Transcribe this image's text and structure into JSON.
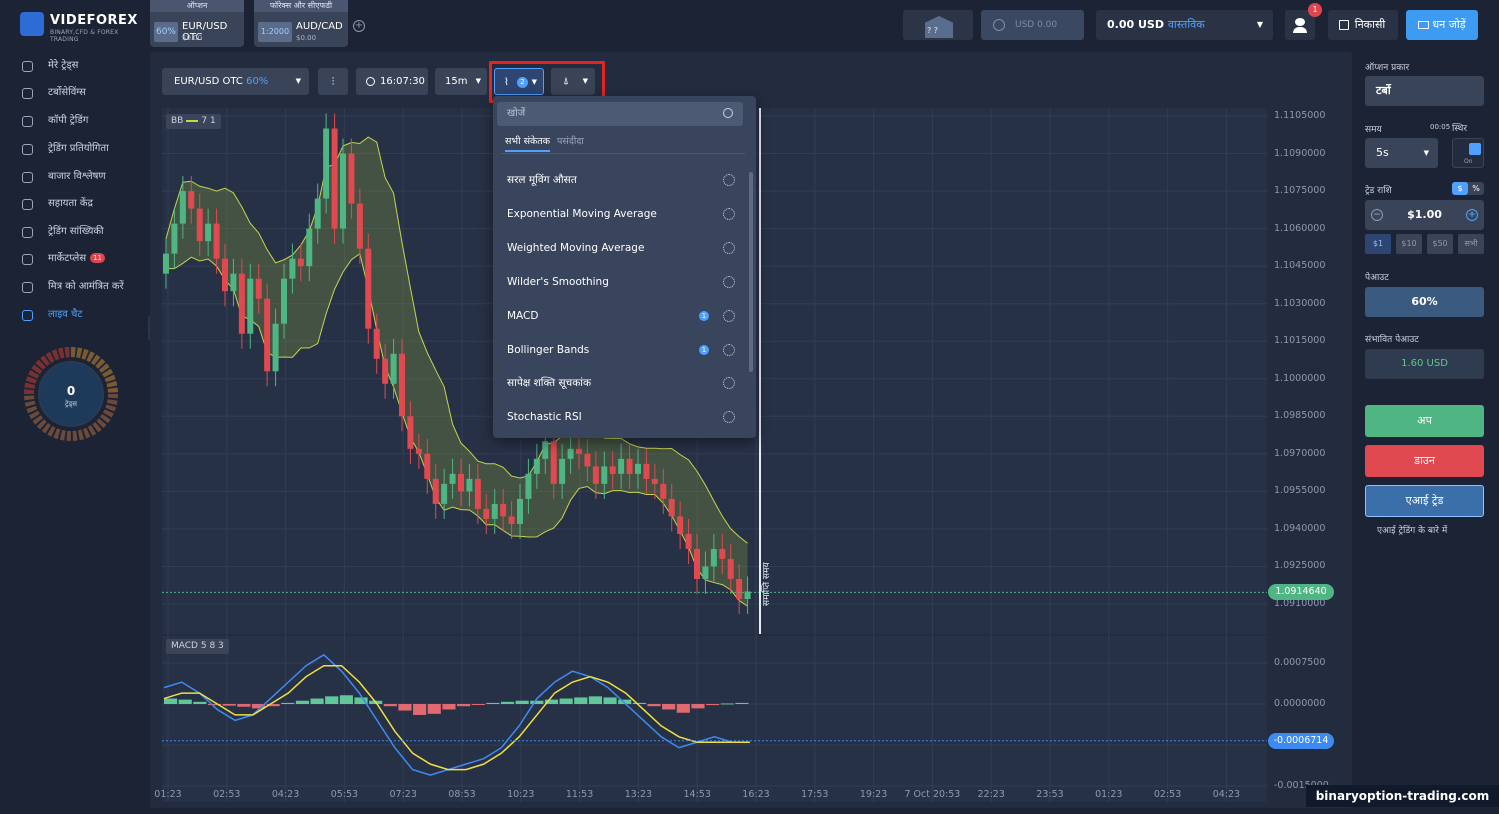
{
  "brand": {
    "name": "VIDEFOREX",
    "tagline": "BINARY,CFD & FOREX TRADING"
  },
  "asset_tabs": [
    {
      "category": "ऑप्शन",
      "pct": "60%",
      "name": "EUR/USD OTC",
      "amount": "$0.00"
    },
    {
      "category": "फॉरेक्स और सीएफडी",
      "pct": "1:2000",
      "name": "AUD/CAD",
      "amount": "$0.00"
    }
  ],
  "header": {
    "demo_balance": "USD 0.00",
    "real_balance": "0.00 USD",
    "real_type": "वास्तविक",
    "notifications": "1",
    "withdraw": "निकासी",
    "deposit": "धन जोड़ें",
    "chest_text": "? ?"
  },
  "sidebar": {
    "items": [
      {
        "label": "मेरे ट्रेड्स"
      },
      {
        "label": "टर्बोसेविंग्स"
      },
      {
        "label": "कॉपी ट्रेडिंग"
      },
      {
        "label": "ट्रेडिंग प्रतियोगिता"
      },
      {
        "label": "बाजार विश्लेषण"
      },
      {
        "label": "सहायता केंद्र"
      },
      {
        "label": "ट्रेडिंग सांख्यिकी"
      },
      {
        "label": "मार्केटप्लेस",
        "badge": "11"
      },
      {
        "label": "मित्र को आमंत्रित करें"
      },
      {
        "label": "लाइव चैट"
      }
    ],
    "trades_count": "0",
    "trades_label": "ट्रेड्स"
  },
  "toolbar": {
    "asset": "EUR/USD OTC",
    "asset_pct": "60%",
    "time": "16:07:30",
    "timeframe": "15m",
    "indicator_count": "2"
  },
  "indicators_menu": {
    "search_placeholder": "खोजें",
    "tabs": [
      "सभी संकेतक",
      "पसंदीदा"
    ],
    "items": [
      {
        "label": "सरल मूविंग औसत",
        "count": ""
      },
      {
        "label": "Exponential Moving Average",
        "count": ""
      },
      {
        "label": "Weighted Moving Average",
        "count": ""
      },
      {
        "label": "Wilder's Smoothing",
        "count": ""
      },
      {
        "label": "MACD",
        "count": "1"
      },
      {
        "label": "Bollinger Bands",
        "count": "1"
      },
      {
        "label": "सापेक्ष शक्ति सूचकांक",
        "count": ""
      },
      {
        "label": "Stochastic RSI",
        "count": ""
      }
    ]
  },
  "chart": {
    "bb_legend": "BB",
    "bb_params": "7 1",
    "macd_legend": "MACD",
    "macd_params": "5 8 3",
    "expiry_label": "समाप्ति समय",
    "current_price": "1.0914640",
    "current_macd": "-0.0006714",
    "colors": {
      "up": "#4fb583",
      "down": "#e0494f",
      "band": "#c7d44f",
      "macd_line": "#3d8bf2",
      "signal": "#f0e040"
    }
  },
  "chart_data": {
    "type": "candlestick",
    "price_ticks": [
      "1.1105000",
      "1.1090000",
      "1.1075000",
      "1.1060000",
      "1.1045000",
      "1.1030000",
      "1.1015000",
      "1.1000000",
      "1.0985000",
      "1.0970000",
      "1.0955000",
      "1.0940000",
      "1.0925000",
      "1.0910000"
    ],
    "macd_ticks": [
      "0.0007500",
      "0.0000000",
      "-0.0007500",
      "-0.0015000"
    ],
    "time_ticks": [
      "01:23",
      "02:53",
      "04:23",
      "05:53",
      "07:23",
      "08:53",
      "10:23",
      "11:53",
      "13:23",
      "14:53",
      "16:23",
      "17:53",
      "19:23",
      "7 Oct 20:53",
      "22:23",
      "23:53",
      "01:23",
      "02:53",
      "04:23"
    ],
    "close": [
      1.105,
      1.1062,
      1.1075,
      1.1068,
      1.1055,
      1.1062,
      1.1048,
      1.1035,
      1.1042,
      1.1018,
      1.104,
      1.1032,
      1.1003,
      1.1022,
      1.104,
      1.1048,
      1.1045,
      1.106,
      1.1072,
      1.11,
      1.106,
      1.109,
      1.107,
      1.1052,
      1.102,
      1.1008,
      1.0998,
      1.101,
      1.0985,
      1.0972,
      1.097,
      1.096,
      1.095,
      1.0958,
      1.0962,
      1.0955,
      1.096,
      1.0948,
      1.0944,
      1.095,
      1.0945,
      1.0942,
      1.0952,
      1.0962,
      1.0968,
      1.0975,
      1.0958,
      1.0968,
      1.0972,
      1.097,
      1.0965,
      1.0958,
      1.0965,
      1.0962,
      1.0968,
      1.0962,
      1.0966,
      1.096,
      1.0958,
      1.0952,
      1.0945,
      1.0938,
      1.0932,
      1.092,
      1.0925,
      1.0932,
      1.0928,
      1.092,
      1.0912,
      1.0915
    ],
    "macd_hist": [
      0.0001,
      8e-05,
      4e-05,
      -2e-05,
      -3e-05,
      -5e-05,
      -8e-05,
      -4e-05,
      2e-05,
      6e-05,
      0.0001,
      0.00014,
      0.00016,
      0.00012,
      6e-05,
      -4e-05,
      -0.00012,
      -0.0002,
      -0.00018,
      -0.0001,
      -4e-05,
      -1e-05,
      2e-05,
      4e-05,
      6e-05,
      6e-05,
      8e-05,
      0.0001,
      0.00012,
      0.00014,
      0.00012,
      8e-05,
      2e-05,
      -4e-05,
      -0.0001,
      -0.00016,
      -8e-05,
      -2e-05,
      1e-05,
      2e-05
    ],
    "macd_line": [
      0.0003,
      0.0004,
      0.0002,
      -0.0001,
      -0.0003,
      -0.0002,
      0.0001,
      0.0004,
      0.0007,
      0.0009,
      0.0006,
      0.0002,
      -0.0003,
      -0.0008,
      -0.0012,
      -0.0013,
      -0.0012,
      -0.0011,
      -0.001,
      -0.0008,
      -0.0004,
      0.0001,
      0.0004,
      0.0006,
      0.0005,
      0.0003,
      0.0,
      -0.0003,
      -0.0006,
      -0.0008,
      -0.0007,
      -0.0006,
      -0.0007,
      -0.0007
    ],
    "signal_line": [
      0.0001,
      0.0002,
      0.0002,
      0.0,
      -0.0002,
      -0.0002,
      0.0,
      0.0002,
      0.0005,
      0.0007,
      0.0007,
      0.0004,
      0.0,
      -0.0005,
      -0.0009,
      -0.0011,
      -0.0012,
      -0.0012,
      -0.0011,
      -0.0009,
      -0.0006,
      -0.0002,
      0.0002,
      0.0004,
      0.0005,
      0.0004,
      0.0002,
      -0.0001,
      -0.0004,
      -0.0006,
      -0.0007,
      -0.0007,
      -0.0007,
      -0.0007
    ]
  },
  "right_panel": {
    "option_type_label": "ऑप्शन प्रकार",
    "option_type": "टर्बो",
    "time_label": "समय",
    "time_now": "00:05",
    "fixed_label": "स्थिर",
    "fixed_state": "On",
    "time_value": "5s",
    "amount_label": "ट्रेड राशि",
    "currency_toggle": [
      "$",
      "%"
    ],
    "amount": "$1.00",
    "presets": [
      "$1",
      "$10",
      "$50",
      "सभी"
    ],
    "payout_label": "पेआउट",
    "payout": "60%",
    "potential_label": "संभावित पेआउट",
    "potential": "1.60 USD",
    "up": "अप",
    "down": "डाउन",
    "ai": "एआई ट्रेड",
    "ai_about": "एआई ट्रेडिंग के बारे में"
  },
  "watermark": "binaryoption-trading.com"
}
